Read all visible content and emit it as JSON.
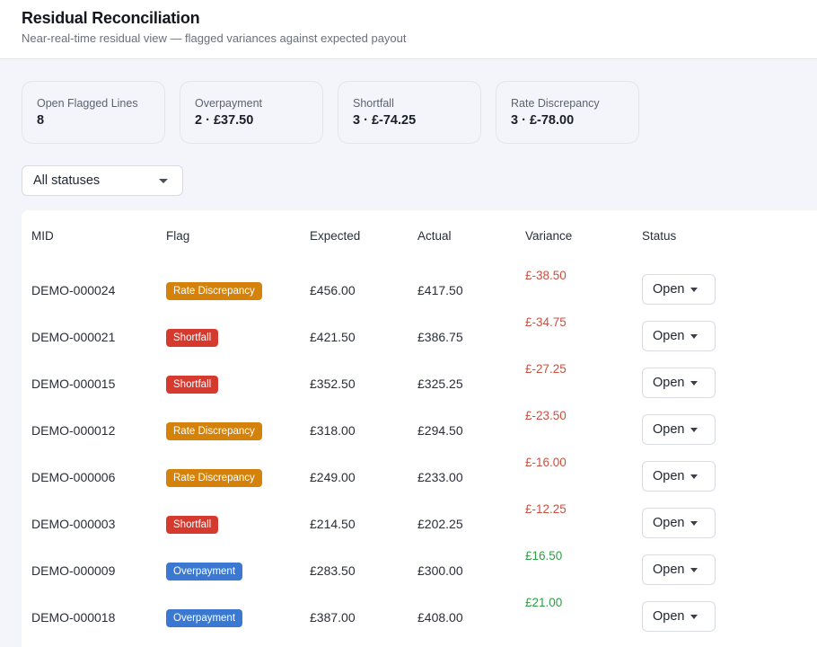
{
  "header": {
    "title": "Residual Reconciliation",
    "subtitle": "Near-real-time residual view — flagged variances against expected payout"
  },
  "stats": [
    {
      "label": "Open Flagged Lines",
      "value": "8"
    },
    {
      "label": "Overpayment",
      "value": "2 · £37.50"
    },
    {
      "label": "Shortfall",
      "value": "3 · £-74.25"
    },
    {
      "label": "Rate Discrepancy",
      "value": "3 · £-78.00"
    }
  ],
  "filter": {
    "selected": "All statuses"
  },
  "colors": {
    "rate_discrepancy": "#d4820a",
    "shortfall": "#d63a2f",
    "overpayment": "#3a78d2",
    "negative_variance": "#c9503e",
    "positive_variance": "#2e9e44"
  },
  "table": {
    "columns": [
      "MID",
      "Flag",
      "Expected",
      "Actual",
      "Variance",
      "Status"
    ],
    "rows": [
      {
        "mid": "DEMO-000024",
        "flag": "Rate Discrepancy",
        "expected": "£456.00",
        "actual": "£417.50",
        "variance": "£-38.50",
        "status": "Open"
      },
      {
        "mid": "DEMO-000021",
        "flag": "Shortfall",
        "expected": "£421.50",
        "actual": "£386.75",
        "variance": "£-34.75",
        "status": "Open"
      },
      {
        "mid": "DEMO-000015",
        "flag": "Shortfall",
        "expected": "£352.50",
        "actual": "£325.25",
        "variance": "£-27.25",
        "status": "Open"
      },
      {
        "mid": "DEMO-000012",
        "flag": "Rate Discrepancy",
        "expected": "£318.00",
        "actual": "£294.50",
        "variance": "£-23.50",
        "status": "Open"
      },
      {
        "mid": "DEMO-000006",
        "flag": "Rate Discrepancy",
        "expected": "£249.00",
        "actual": "£233.00",
        "variance": "£-16.00",
        "status": "Open"
      },
      {
        "mid": "DEMO-000003",
        "flag": "Shortfall",
        "expected": "£214.50",
        "actual": "£202.25",
        "variance": "£-12.25",
        "status": "Open"
      },
      {
        "mid": "DEMO-000009",
        "flag": "Overpayment",
        "expected": "£283.50",
        "actual": "£300.00",
        "variance": "£16.50",
        "status": "Open"
      },
      {
        "mid": "DEMO-000018",
        "flag": "Overpayment",
        "expected": "£387.00",
        "actual": "£408.00",
        "variance": "£21.00",
        "status": "Open"
      }
    ]
  }
}
